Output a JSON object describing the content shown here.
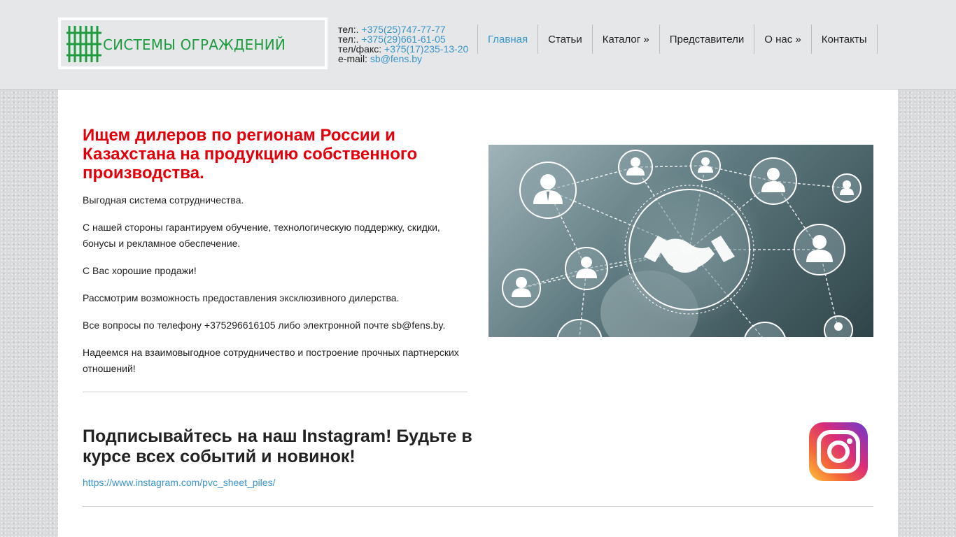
{
  "header": {
    "logo_text": "СИСТЕМЫ ОГРАЖДЕНИЙ",
    "contacts": [
      {
        "label": "тел:.",
        "value": "+375(25)747-77-77"
      },
      {
        "label": "тел:.",
        "value": "+375(29)661-61-05"
      },
      {
        "label": "тел/факс:",
        "value": "+375(17)235-13-20"
      },
      {
        "label": "e-mail:",
        "value": "sb@fens.by"
      }
    ]
  },
  "nav": {
    "items": [
      "Главная",
      "Статьи",
      "Каталог »",
      "Представители",
      "О нас »",
      "Контакты"
    ]
  },
  "dealers": {
    "title": "Ищем дилеров по регионам России и Казахстана на продукцию собственного производства.",
    "paragraphs": [
      "Выгодная система сотрудничества.",
      "С нашей стороны гарантируем обучение, технологическую поддержку, скидки, бонусы и рекламное обеспечение.",
      "С Вас хорошие продажи!",
      "Рассмотрим возможность предоставления эксклюзивного дилерства.",
      "Все вопросы по телефону +375296616105 либо электронной почте sb@fens.by.",
      "Надеемся на взаимовыгодное сотрудничество и построение прочных партнерских отношений!"
    ]
  },
  "instagram": {
    "title": "Подписывайтесь на наш Instagram! Будьте в курсе всех событий и новинок!",
    "link": "https://www.instagram.com/pvc_sheet_piles/"
  },
  "colors": {
    "accent": "#3a94c8",
    "headline_red": "#e3000b",
    "logo_green": "#1f9c42"
  }
}
